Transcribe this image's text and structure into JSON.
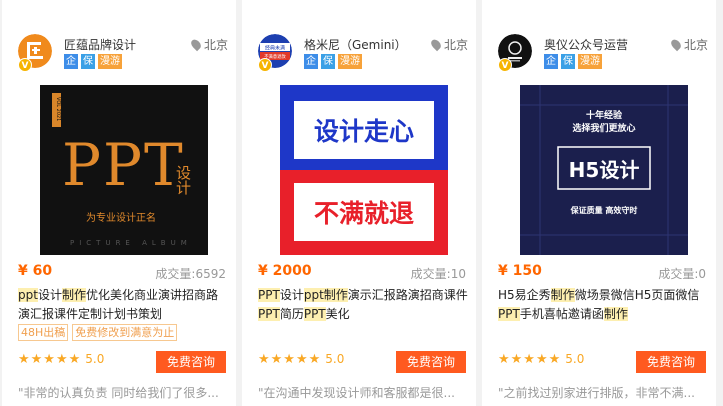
{
  "cards": [
    {
      "shop_name": "匠蕴品牌设计",
      "location": "北京",
      "tags": [
        "企",
        "保",
        "漫游"
      ],
      "price": "¥ 60",
      "sales": "成交量:6592",
      "title_parts": [
        {
          "text": "ppt",
          "hl": true
        },
        {
          "text": "设计",
          "hl": false
        },
        {
          "text": "制作",
          "hl": true
        },
        {
          "text": "优化美化商业演讲招商路演汇报课件定制计划书策划",
          "hl": false
        }
      ],
      "labels": [
        "48H出稿",
        "免费修改到满意为止"
      ],
      "score": "5.0",
      "consult_label": "免费咨询",
      "review": "\"非常的认真负责 同时给我们了很多...",
      "thumb": {
        "big_text": "PPT",
        "side_text": "设计",
        "vertical_small": "VOL 2021",
        "caption": "为专业设计正名",
        "footer": "PICTURE ALBUM"
      }
    },
    {
      "shop_name": "格米尼（Gemini）",
      "location": "北京",
      "tags": [
        "企",
        "保",
        "漫游"
      ],
      "price": "¥ 2000",
      "sales": "成交量:10",
      "title_parts": [
        {
          "text": "PPT",
          "hl": true
        },
        {
          "text": "设计",
          "hl": false
        },
        {
          "text": "ppt制作",
          "hl": true
        },
        {
          "text": "演示汇报路演招商课件",
          "hl": false
        },
        {
          "text": "PPT",
          "hl": true
        },
        {
          "text": "简历",
          "hl": false
        },
        {
          "text": "PPT",
          "hl": true
        },
        {
          "text": "美化",
          "hl": false
        }
      ],
      "labels": [],
      "score": "5.0",
      "consult_label": "免费咨询",
      "review": "\"在沟通中发现设计师和客服都是很...",
      "avatar_text": [
        "经典未满",
        "不满意退款"
      ],
      "thumb": {
        "line1": "设计走心",
        "line2": "不满就退"
      }
    },
    {
      "shop_name": "奥仪公众号运营",
      "location": "北京",
      "tags": [
        "企",
        "保",
        "漫游"
      ],
      "price": "¥ 150",
      "sales": "成交量:0",
      "title_parts": [
        {
          "text": "H5易企秀",
          "hl": false
        },
        {
          "text": "制作",
          "hl": true
        },
        {
          "text": "微场景微信H5页面微信",
          "hl": false
        },
        {
          "text": "PPT",
          "hl": true
        },
        {
          "text": "手机喜帖邀请函",
          "hl": false
        },
        {
          "text": "制作",
          "hl": true
        }
      ],
      "labels": [],
      "score": "5.0",
      "consult_label": "免费咨询",
      "review": "\"之前找过别家进行排版，非常不满...",
      "thumb": {
        "top1": "十年经验",
        "top2": "选择我们更放心",
        "main": "H5设计",
        "sub": "保证质量  高效守时"
      }
    }
  ],
  "colors": {
    "price": "#ff6600",
    "consult_bg": "#ff5a1f",
    "highlight": "#fdefb0",
    "tag_blue": "#3d8de8",
    "tag_orange": "#f7a23a",
    "star": "#f9a825"
  }
}
